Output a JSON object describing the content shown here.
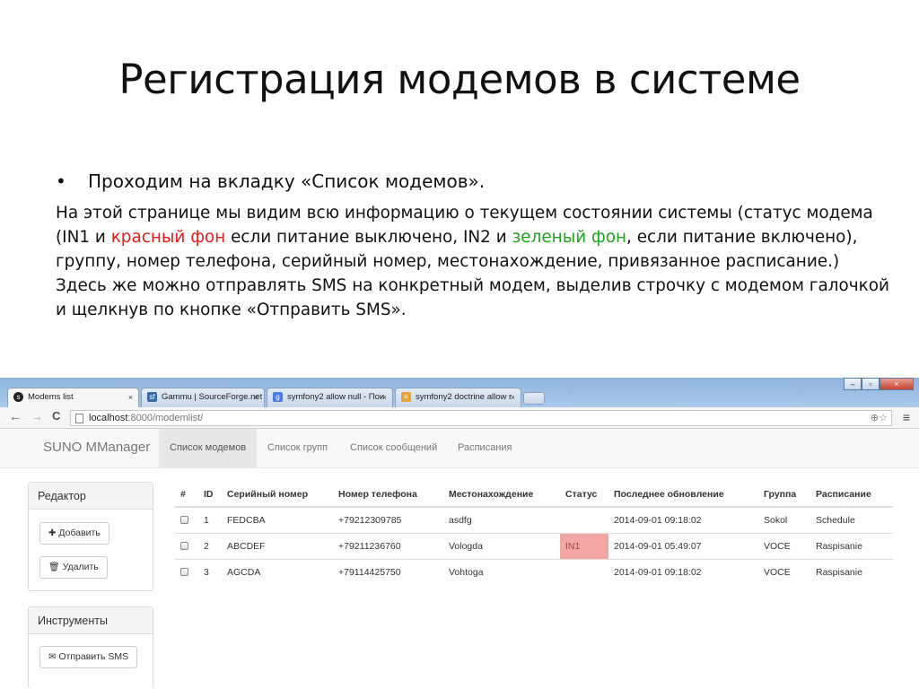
{
  "slide": {
    "title": "Регистрация модемов в системе",
    "bullet": "Проходим на вкладку «Список модемов».",
    "body_1": "На этой странице мы видим всю информацию о текущем состоянии системы (статус модема (IN1 и ",
    "body_red": "красный фон",
    "body_2": " если питание выключено, IN2 и ",
    "body_green": "зеленый фон",
    "body_3": ", если питание включено), группу, номер телефона, серийный номер, местонахождение, привязанное расписание.) Здесь же можно отправлять SMS на конкретный модем, выделив строчку с модемом галочкой и щелкнув по кнопке «Отправить SMS».",
    "colors": {
      "red": "#e0201d",
      "green": "#1fa31f"
    }
  },
  "browser": {
    "tabs": [
      {
        "label": "Modems list",
        "icon": "symfony-icon",
        "close": "×"
      },
      {
        "label": "Gammu | SourceForge.net",
        "icon": "sourceforge-icon",
        "close": "×"
      },
      {
        "label": "symfony2 allow null - Пои",
        "icon": "google-icon",
        "close": "×"
      },
      {
        "label": "symfony2 doctrine allow r",
        "icon": "stackoverflow-icon",
        "close": "×"
      }
    ],
    "address_host": "localhost",
    "address_path": ":8000/modemlist/",
    "nav_back": "←",
    "nav_forward": "→",
    "nav_reload": "C",
    "zoom_icon": "⊕☆",
    "menu_icon": "≡",
    "window_controls": [
      "–",
      "▫",
      "×"
    ]
  },
  "app": {
    "brand": "SUNO MManager",
    "nav": [
      {
        "label": "Список модемов",
        "active": true
      },
      {
        "label": "Список групп",
        "active": false
      },
      {
        "label": "Список сообщений",
        "active": false
      },
      {
        "label": "Расписания",
        "active": false
      }
    ],
    "editor_panel": {
      "title": "Редактор",
      "add_button": "Добавить",
      "delete_button": "Удалить"
    },
    "tools_panel": {
      "title": "Инструменты",
      "sms_button": "Отправить SMS"
    },
    "table": {
      "headers": [
        "#",
        "ID",
        "Серийный номер",
        "Номер телефона",
        "Местонахождение",
        "Статус",
        "Последнее обновление",
        "Группа",
        "Расписание"
      ],
      "rows": [
        {
          "id": "1",
          "serial": "FEDCBA",
          "phone": "+79212309785",
          "location": "asdfg",
          "status": "",
          "updated": "2014-09-01 09:18:02",
          "group": "Sokol",
          "schedule": "Schedule"
        },
        {
          "id": "2",
          "serial": "ABCDEF",
          "phone": "+79211236760",
          "location": "Vologda",
          "status": "IN1",
          "updated": "2014-09-01 05:49:07",
          "group": "VOCE",
          "schedule": "Raspisanie"
        },
        {
          "id": "3",
          "serial": "AGCDA",
          "phone": "+79114425750",
          "location": "Vohtoga",
          "status": "",
          "updated": "2014-09-01 09:18:02",
          "group": "VOCE",
          "schedule": "Raspisanie"
        }
      ]
    }
  }
}
